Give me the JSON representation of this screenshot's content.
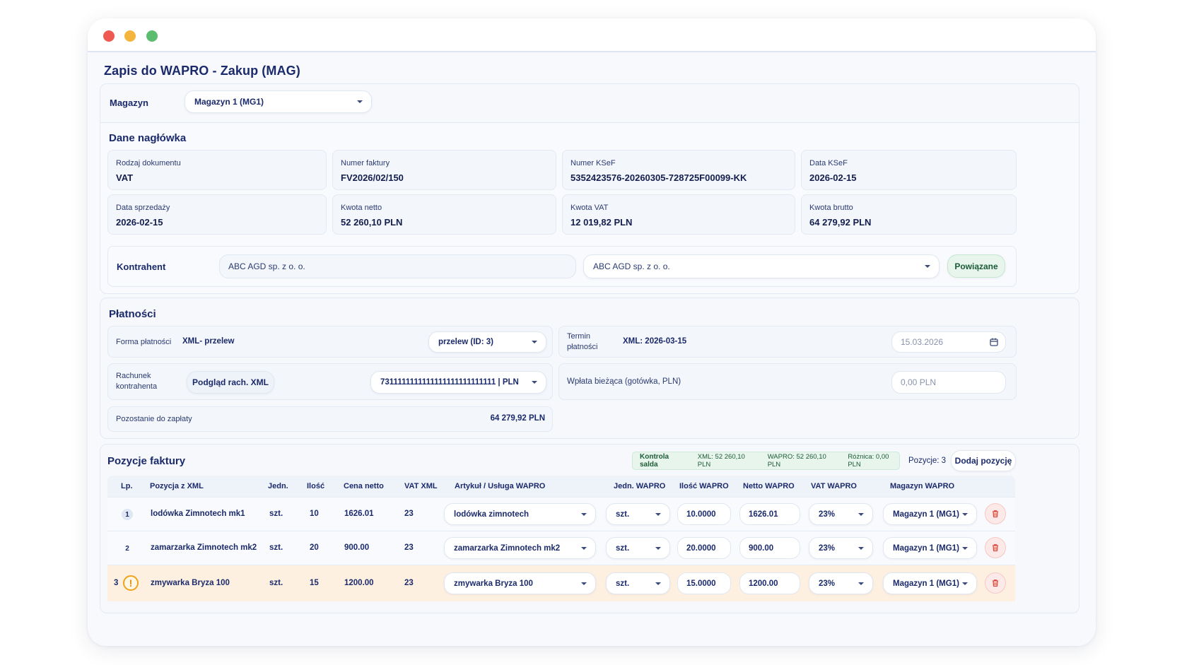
{
  "page_title": "Zapis do WAPRO - Zakup (MAG)",
  "magazyn": {
    "label": "Magazyn",
    "value": "Magazyn 1 (MG1)"
  },
  "header_section": {
    "title": "Dane nagłówka",
    "fields": [
      {
        "label": "Rodzaj dokumentu",
        "value": "VAT"
      },
      {
        "label": "Numer faktury",
        "value": "FV2026/02/150"
      },
      {
        "label": "Numer KSeF",
        "value": "5352423576-20260305-728725F00099-KK"
      },
      {
        "label": "Data KSeF",
        "value": "2026-02-15"
      },
      {
        "label": "Data sprzedaży",
        "value": "2026-02-15"
      },
      {
        "label": "Kwota netto",
        "value": "52 260,10 PLN"
      },
      {
        "label": "Kwota VAT",
        "value": "12 019,82 PLN"
      },
      {
        "label": "Kwota brutto",
        "value": "64 279,92 PLN"
      }
    ],
    "kontrahent": {
      "label": "Kontrahent",
      "xml_value": "ABC AGD sp. z o. o.",
      "select_value": "ABC AGD sp. z o. o.",
      "button": "Powiązane"
    }
  },
  "payments": {
    "title": "Płatności",
    "forma": {
      "label": "Forma płatności",
      "xml": "XML- przelew",
      "select": "przelew (ID: 3)"
    },
    "termin": {
      "label_line1": "Termin",
      "label_line2": "płatności",
      "xml": "XML: 2026-03-15",
      "date": "15.03.2026"
    },
    "rachunek": {
      "label_line1": "Rachunek",
      "label_line2": "kontrahenta",
      "button": "Podgląd rach. XML",
      "select": "7311111111111111111111111111 | PLN"
    },
    "wplata": {
      "label": "Wpłata bieżąca (gotówka, PLN)",
      "value": "0,00 PLN"
    },
    "pozostanie": {
      "label": "Pozostanie do zapłaty",
      "value": "64 279,92 PLN"
    }
  },
  "items": {
    "title": "Pozycje faktury",
    "saldo": {
      "title": "Kontrola salda",
      "xml": "XML: 52 260,10 PLN",
      "wapro": "WAPRO: 52 260,10 PLN",
      "roznica": "Różnica: 0,00 PLN"
    },
    "count_label": "Pozycje: 3",
    "add_button": "Dodaj pozycję",
    "columns": [
      "Lp.",
      "Pozycja z XML",
      "Jedn.",
      "Ilość",
      "Cena netto",
      "VAT XML",
      "Artykuł / Usługa WAPRO",
      "Jedn. WAPRO",
      "Ilość WAPRO",
      "Netto WAPRO",
      "VAT WAPRO",
      "Magazyn WAPRO"
    ],
    "rows": [
      {
        "lp": "1",
        "name": "lodówka Zimnotech mk1",
        "unit": "szt.",
        "qty": "10",
        "price": "1626.01",
        "vat": "23",
        "article": "lodówka zimnotech",
        "unit_w": "szt.",
        "qty_w": "10.0000",
        "net_w": "1626.01",
        "vat_w": "23%",
        "mag_w": "Magazyn 1 (MG1)",
        "warning": false
      },
      {
        "lp": "2",
        "name": "zamarzarka Zimnotech mk2",
        "unit": "szt.",
        "qty": "20",
        "price": "900.00",
        "vat": "23",
        "article": "zamarzarka Zimnotech mk2",
        "unit_w": "szt.",
        "qty_w": "20.0000",
        "net_w": "900.00",
        "vat_w": "23%",
        "mag_w": "Magazyn 1 (MG1)",
        "warning": false
      },
      {
        "lp": "3",
        "name": "zmywarka Bryza 100",
        "unit": "szt.",
        "qty": "15",
        "price": "1200.00",
        "vat": "23",
        "article": "zmywarka Bryza 100",
        "unit_w": "szt.",
        "qty_w": "15.0000",
        "net_w": "1200.00",
        "vat_w": "23%",
        "mag_w": "Magazyn 1 (MG1)",
        "warning": true
      }
    ]
  }
}
